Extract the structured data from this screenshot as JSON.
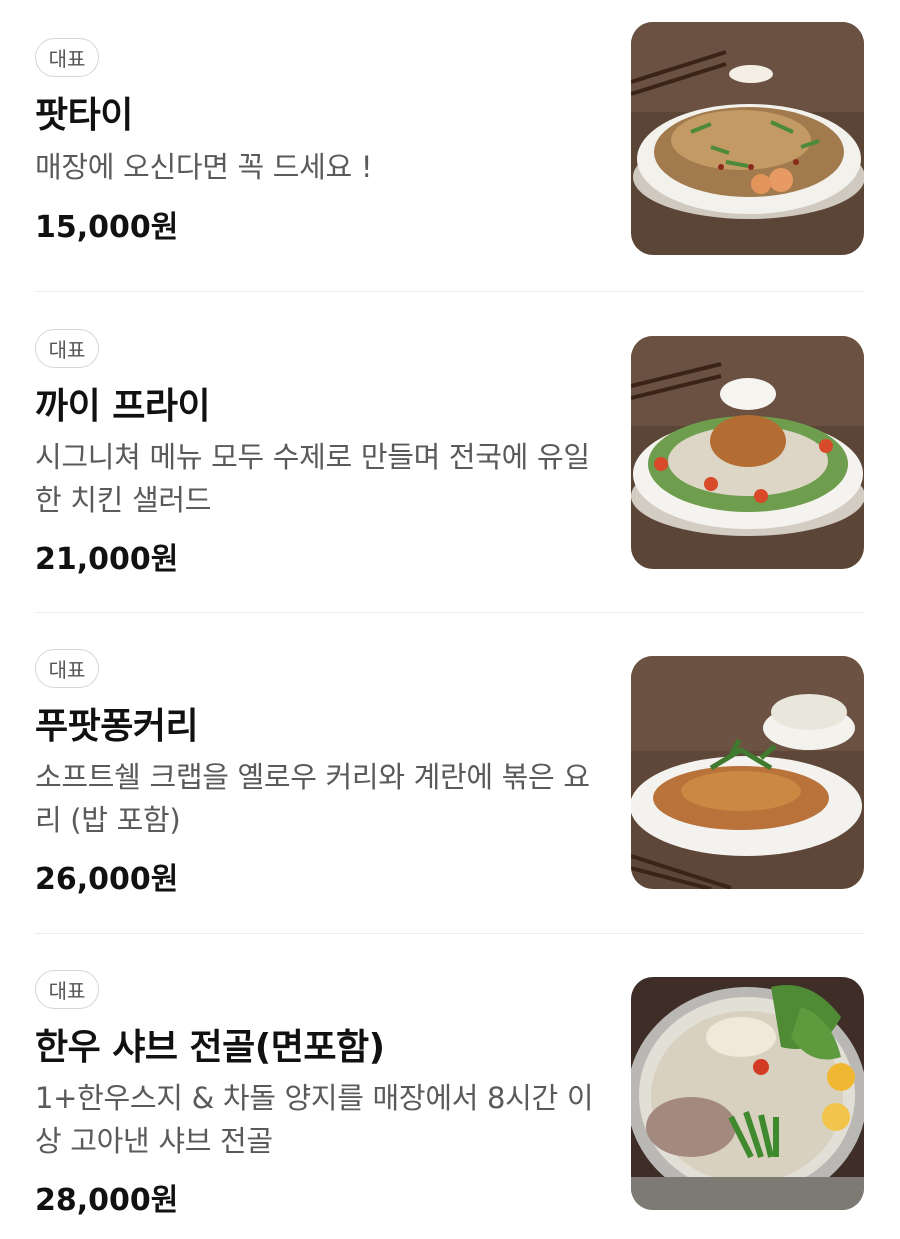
{
  "menu": {
    "items": [
      {
        "badge": "대표",
        "name": "팟타이",
        "description": "매장에 오신다면 꼭 드세요 !",
        "price": "15,000원",
        "image_icon": "pad-thai-photo"
      },
      {
        "badge": "대표",
        "name": "까이 프라이",
        "description": "시그니쳐 메뉴 모두 수제로 만들며 전국에 유일한 치킨 샐러드",
        "price": "21,000원",
        "image_icon": "fried-chicken-salad-photo"
      },
      {
        "badge": "대표",
        "name": "푸팟퐁커리",
        "description": "소프트쉘 크랩을 옐로우 커리와 계란에 볶은 요리 (밥 포함)",
        "price": "26,000원",
        "image_icon": "curry-crab-photo"
      },
      {
        "badge": "대표",
        "name": "한우 샤브 전골(면포함)",
        "description": "1+한우스지 & 차돌 양지를 매장에서 8시간 이상 고아낸 샤브 전골",
        "price": "28,000원",
        "image_icon": "shabu-hotpot-photo"
      }
    ]
  },
  "colors": {
    "background": "#ffffff",
    "text_primary": "#111111",
    "text_secondary": "#5a5a5a",
    "badge_border": "#d6d6d6",
    "divider": "#ececec",
    "table_wood": "#5b4536"
  }
}
